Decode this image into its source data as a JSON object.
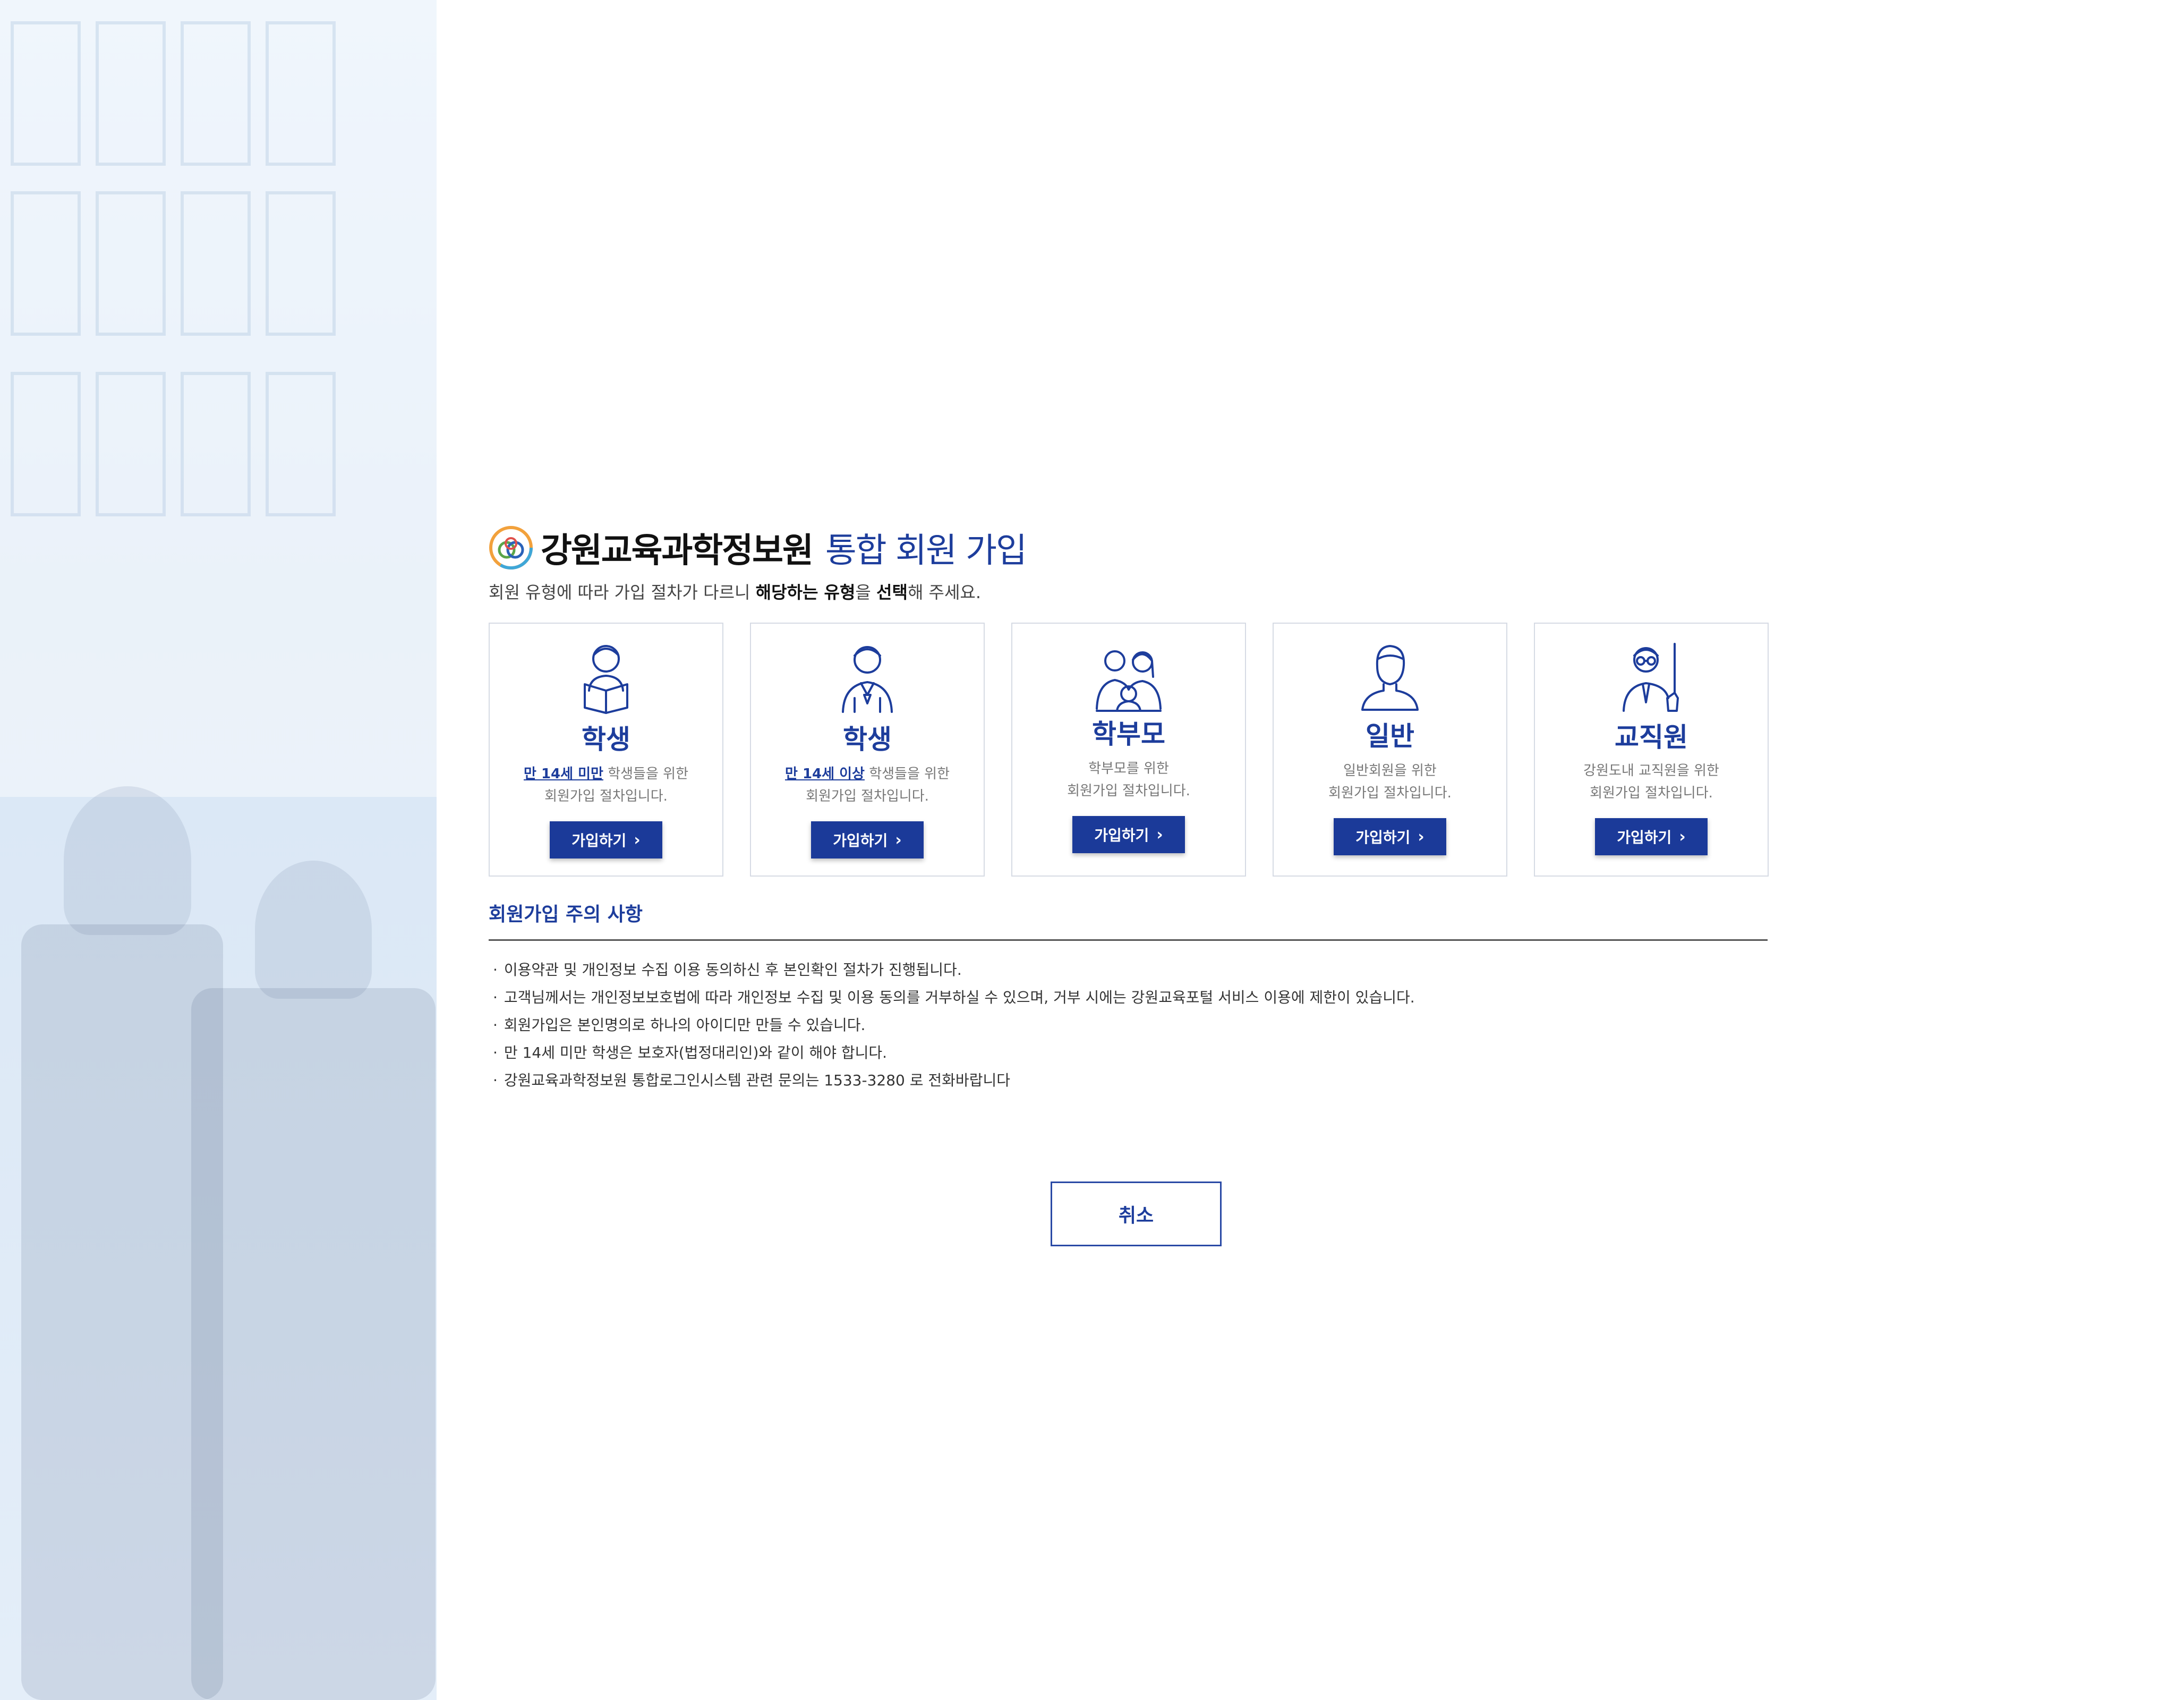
{
  "header": {
    "org_name": "강원교육과학정보원",
    "title_suffix": "통합 회원 가입"
  },
  "subtitle": {
    "part1": "회원 유형에 따라 가입 절차가 다르니 ",
    "bold1": "해당하는 유형",
    "part2": "을 ",
    "bold2": "선택",
    "part3": "해 주세요."
  },
  "cards": [
    {
      "label": "학생",
      "desc_emph": "만 14세 미만",
      "desc_line1": " 학생들을 위한",
      "desc_line2": "회원가입 절차입니다.",
      "button": "가입하기",
      "icon": "student-reading-icon"
    },
    {
      "label": "학생",
      "desc_emph": "만 14세 이상",
      "desc_line1": " 학생들을 위한",
      "desc_line2": "회원가입 절차입니다.",
      "button": "가입하기",
      "icon": "student-uniform-icon"
    },
    {
      "label": "학부모",
      "desc_line1": "학부모를 위한",
      "desc_line2": "회원가입 절차입니다.",
      "button": "가입하기",
      "icon": "parents-icon"
    },
    {
      "label": "일반",
      "desc_line1": "일반회원을 위한",
      "desc_line2": "회원가입 절차입니다.",
      "button": "가입하기",
      "icon": "person-icon"
    },
    {
      "label": "교직원",
      "desc_line1": "강원도내 교직원을 위한",
      "desc_line2": "회원가입 절차입니다.",
      "button": "가입하기",
      "icon": "teacher-icon"
    }
  ],
  "notice": {
    "title": "회원가입 주의 사항",
    "items": [
      "이용약관 및 개인정보 수집 이용 동의하신 후 본인확인 절차가 진행됩니다.",
      "고객님께서는 개인정보보호법에 따라 개인정보 수집 및 이용 동의를 거부하실 수 있으며, 거부 시에는 강원교육포털 서비스 이용에 제한이 있습니다.",
      "회원가입은 본인명의로 하나의 아이디만 만들 수 있습니다.",
      "만 14세 미만 학생은 보호자(법정대리인)와 같이 해야 합니다.",
      "강원교육과학정보원 통합로그인시스템 관련 문의는 1533-3280 로 전화바랍니다"
    ]
  },
  "cancel_label": "취소",
  "colors": {
    "accent": "#1b3a99",
    "title_blue": "#1d3d9c",
    "side_panel": "#e3eefa"
  }
}
